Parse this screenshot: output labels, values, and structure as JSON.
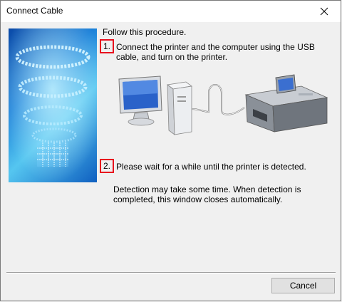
{
  "window": {
    "title": "Connect Cable",
    "close_icon": "close-icon"
  },
  "content": {
    "intro": "Follow this procedure.",
    "steps": [
      {
        "number": "1.",
        "text": "Connect the printer and the computer using the USB cable, and turn on the printer."
      },
      {
        "number": "2.",
        "text": "Please wait for a while until the printer is detected."
      }
    ],
    "note": "Detection may take some time. When detection is completed, this window closes automatically."
  },
  "footer": {
    "cancel_label": "Cancel"
  },
  "colors": {
    "step_highlight": "#e8101e",
    "banner_blue": "#1a7fd8"
  }
}
